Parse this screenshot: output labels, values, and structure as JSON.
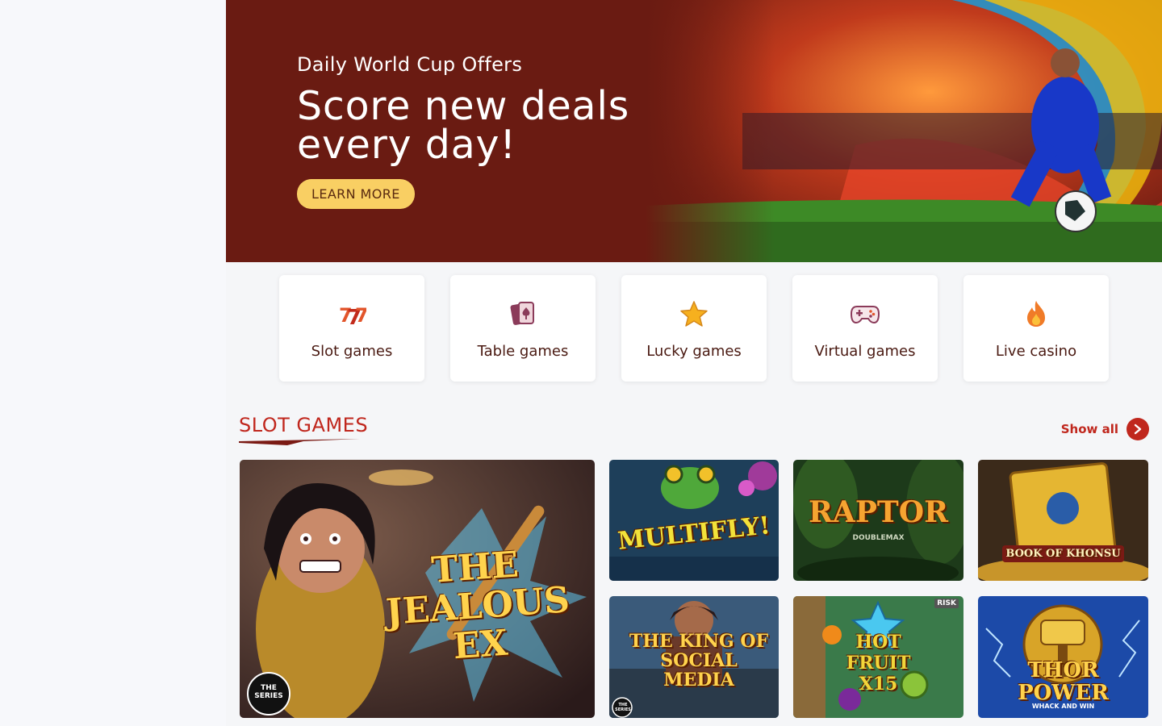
{
  "hero": {
    "kicker": "Daily World Cup Offers",
    "title": "Score new deals every day!",
    "button_label": "LEARN MORE"
  },
  "categories": [
    {
      "label": "Slot games",
      "icon": "slot-777-icon"
    },
    {
      "label": "Table games",
      "icon": "playing-cards-icon"
    },
    {
      "label": "Lucky games",
      "icon": "star-icon"
    },
    {
      "label": "Virtual games",
      "icon": "gamepad-icon"
    },
    {
      "label": "Live casino",
      "icon": "flame-icon"
    }
  ],
  "slot_section": {
    "title": "SLOT GAMES",
    "show_all_label": "Show all"
  },
  "games": [
    {
      "name": "THE JEALOUS EX",
      "badge": "THE SERIES"
    },
    {
      "name": "MULTIFLY!"
    },
    {
      "name": "RAPTOR",
      "sub": "DOUBLEMAX"
    },
    {
      "name": "BOOK OF KHONSU"
    },
    {
      "name": "THE KING OF SOCIAL MEDIA",
      "badge": "THE SERIES"
    },
    {
      "name": "HOT FRUIT X15",
      "badge": "RISK"
    },
    {
      "name": "THOR POWER",
      "sub": "WHACK AND WIN"
    }
  ],
  "colors": {
    "accent": "#c0271d",
    "hero_bg": "#6a1b12",
    "button": "#f9cf63"
  }
}
